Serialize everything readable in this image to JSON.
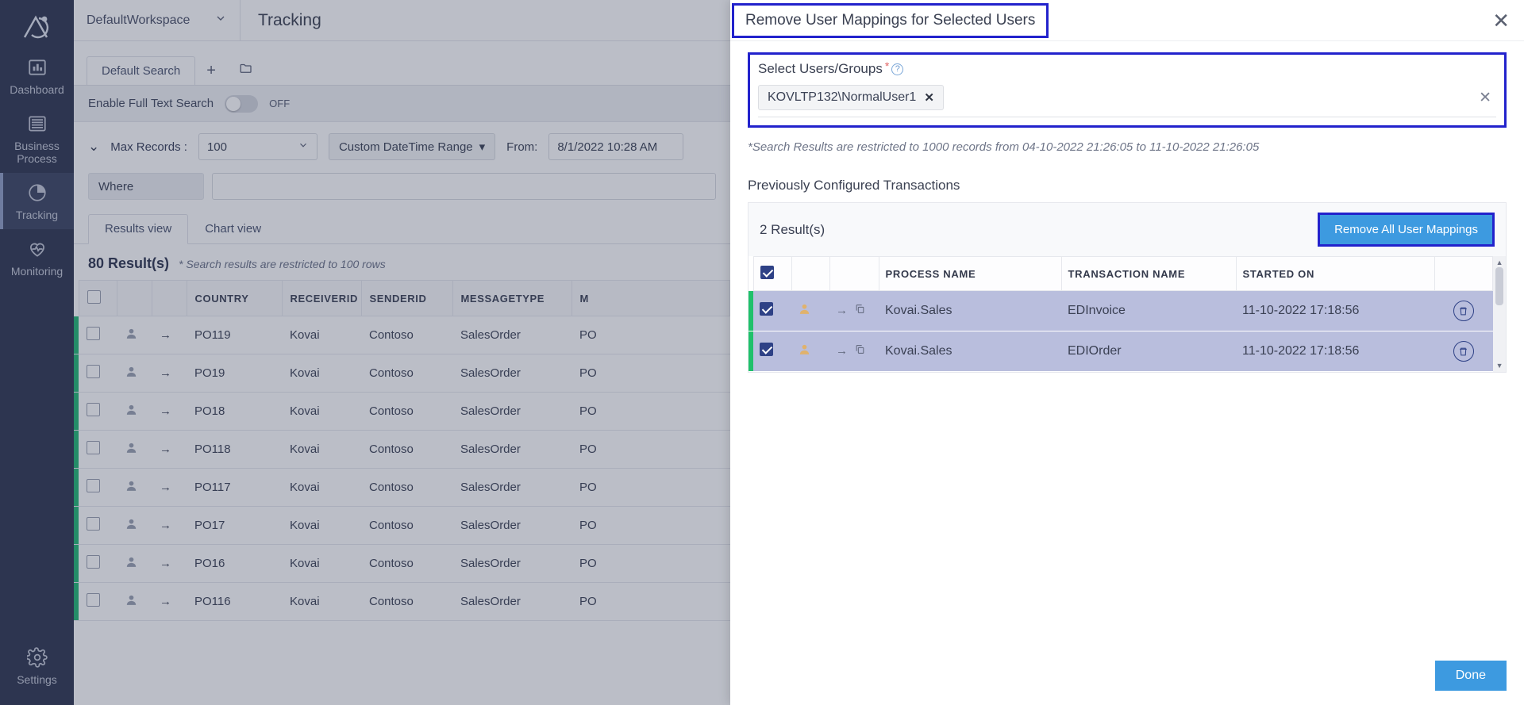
{
  "sidebar": {
    "logo_name": "app-logo",
    "items": [
      {
        "label": "Dashboard",
        "icon": "bar-chart-icon",
        "active": false
      },
      {
        "label": "Business Process",
        "icon": "server-stack-icon",
        "active": false
      },
      {
        "label": "Tracking",
        "icon": "pie-clock-icon",
        "active": true
      },
      {
        "label": "Monitoring",
        "icon": "heart-pulse-icon",
        "active": false
      }
    ],
    "settings": {
      "label": "Settings",
      "icon": "gear-icon"
    }
  },
  "topbar": {
    "workspace": "DefaultWorkspace",
    "workspace_chevron": "chevron-down-icon",
    "page_title": "Tracking"
  },
  "search_tabs": {
    "active_tab": "Default Search",
    "add_icon": "plus-icon",
    "folder_icon": "folder-open-icon"
  },
  "full_text": {
    "label": "Enable Full Text Search",
    "toggle_state": "OFF"
  },
  "filters": {
    "chevron_icon": "chevrons-down-icon",
    "max_records_label": "Max Records :",
    "max_records_value": "100",
    "date_range_button": "Custom DateTime Range",
    "from_label": "From:",
    "from_value": "8/1/2022 10:28 AM",
    "where_label": "Where",
    "where_value": ""
  },
  "view_tabs": {
    "items": [
      "Results view",
      "Chart view"
    ],
    "active": "Results view"
  },
  "results": {
    "count_label": "80 Result(s)",
    "note": "* Search results are restricted to 100 rows",
    "columns": [
      "",
      "",
      "",
      "COUNTRY",
      "RECEIVERID",
      "SENDERID",
      "MESSAGETYPE",
      "M"
    ],
    "rows": [
      {
        "country": "PO119",
        "receiverid": "Kovai",
        "senderid": "Contoso",
        "messagetype": "SalesOrder",
        "more": "PO"
      },
      {
        "country": "PO19",
        "receiverid": "Kovai",
        "senderid": "Contoso",
        "messagetype": "SalesOrder",
        "more": "PO"
      },
      {
        "country": "PO18",
        "receiverid": "Kovai",
        "senderid": "Contoso",
        "messagetype": "SalesOrder",
        "more": "PO"
      },
      {
        "country": "PO118",
        "receiverid": "Kovai",
        "senderid": "Contoso",
        "messagetype": "SalesOrder",
        "more": "PO"
      },
      {
        "country": "PO117",
        "receiverid": "Kovai",
        "senderid": "Contoso",
        "messagetype": "SalesOrder",
        "more": "PO"
      },
      {
        "country": "PO17",
        "receiverid": "Kovai",
        "senderid": "Contoso",
        "messagetype": "SalesOrder",
        "more": "PO"
      },
      {
        "country": "PO16",
        "receiverid": "Kovai",
        "senderid": "Contoso",
        "messagetype": "SalesOrder",
        "more": "PO"
      },
      {
        "country": "PO116",
        "receiverid": "Kovai",
        "senderid": "Contoso",
        "messagetype": "SalesOrder",
        "more": "PO"
      }
    ]
  },
  "modal": {
    "title": "Remove User Mappings for Selected Users",
    "close_icon": "close-icon",
    "select_users": {
      "label": "Select Users/Groups",
      "required_marker": "*",
      "help_icon": "help-circle-icon",
      "tags": [
        {
          "text": "KOVLTP132\\NormalUser1",
          "remove_icon": "x-icon"
        }
      ],
      "clear_icon": "clear-x-icon"
    },
    "restriction_note": "*Search Results are restricted to 1000 records from 04-10-2022 21:26:05 to 11-10-2022 21:26:05",
    "section_title": "Previously Configured Transactions",
    "result_count": "2 Result(s)",
    "remove_all_button": "Remove All User Mappings",
    "table": {
      "columns": [
        "PROCESS NAME",
        "TRANSACTION NAME",
        "STARTED ON"
      ],
      "header_checkbox_checked": true,
      "rows": [
        {
          "checked": true,
          "person_icon": "person-icon",
          "arrow_icon": "arrow-right-icon",
          "copy_icon": "copy-icon",
          "process_name": "Kovai.Sales",
          "transaction_name": "EDInvoice",
          "started_on": "11-10-2022 17:18:56",
          "delete_icon": "trash-icon"
        },
        {
          "checked": true,
          "person_icon": "person-icon",
          "arrow_icon": "arrow-right-icon",
          "copy_icon": "copy-icon",
          "process_name": "Kovai.Sales",
          "transaction_name": "EDIOrder",
          "started_on": "11-10-2022 17:18:56",
          "delete_icon": "trash-icon"
        }
      ]
    },
    "done_button": "Done"
  },
  "colors": {
    "sidebar_bg": "#2e3650",
    "accent_blue": "#3d9ae0",
    "highlight_border": "#2222cc",
    "row_selected": "#b9bedd",
    "status_green": "#1fc16b",
    "checkbox_navy": "#2e4186"
  }
}
